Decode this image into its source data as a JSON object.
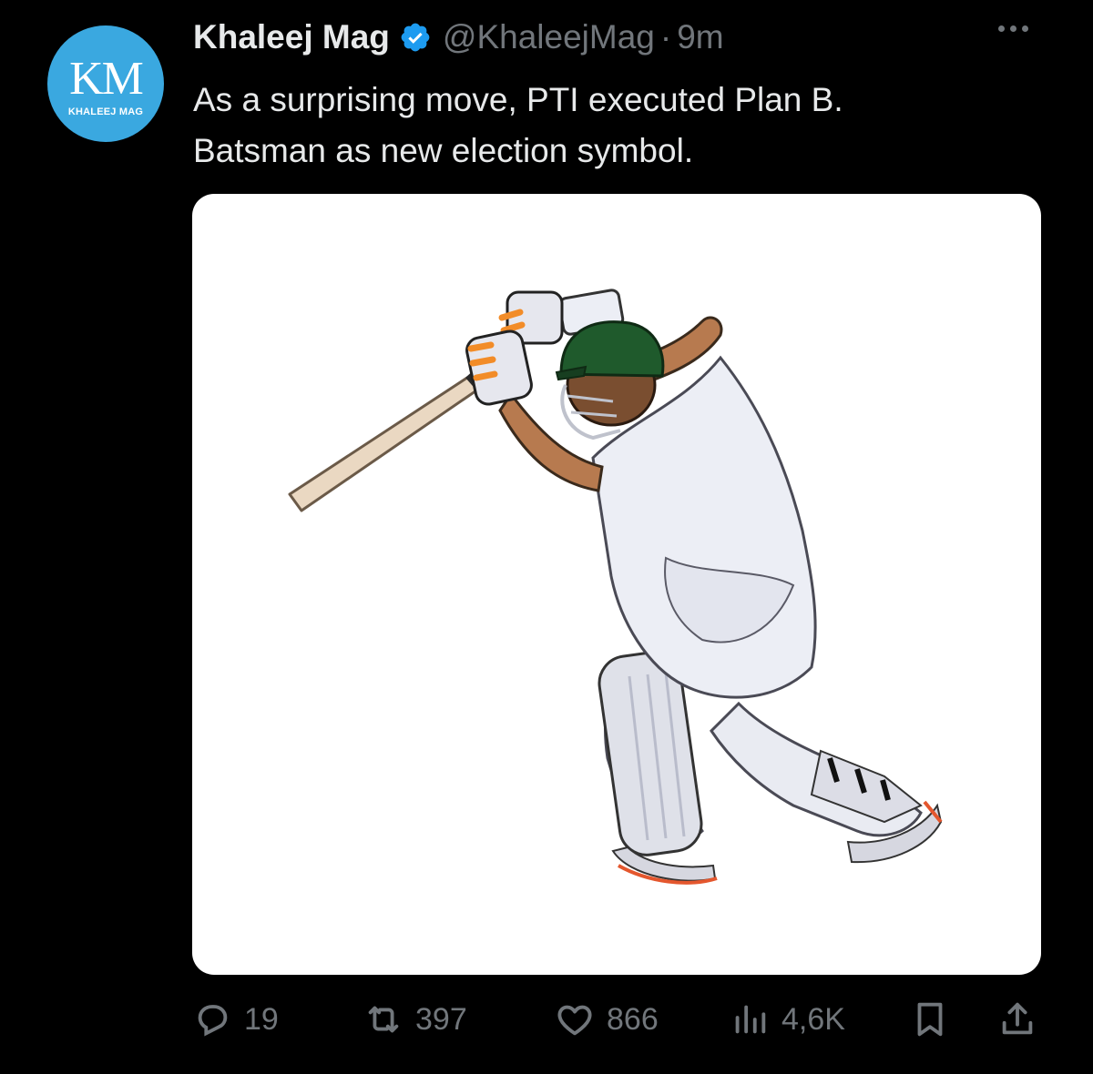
{
  "tweet": {
    "author_name": "Khaleej Mag",
    "handle": "@KhaleejMag",
    "separator": "·",
    "time": "9m",
    "text_lines": [
      "As a surprising move, PTI executed Plan B.",
      "Batsman as new election symbol."
    ],
    "verified": true,
    "avatar": {
      "monogram": "KM",
      "subtitle": "KHALEEJ MAG",
      "color": "#3aa8e0"
    }
  },
  "media": {
    "icon": "cricket-batsman-illustration"
  },
  "actions": {
    "replies": "19",
    "retweets": "397",
    "likes": "866",
    "views": "4,6K"
  },
  "colors": {
    "background": "#000000",
    "text": "#e7e9ea",
    "muted": "#71767b",
    "verified": "#1d9bf0"
  }
}
